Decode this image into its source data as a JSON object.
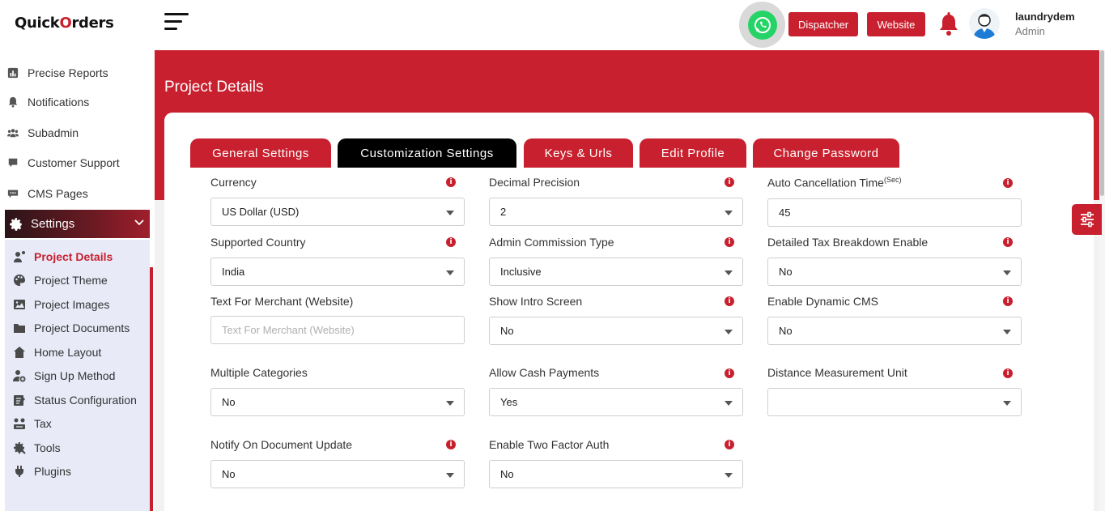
{
  "brand": {
    "logo_text_a": "Quick",
    "logo_text_b": "orders",
    "logo_accent_char": "O"
  },
  "sidebar": {
    "items": [
      {
        "label": "Precise Reports",
        "icon": "report-icon"
      },
      {
        "label": "Notifications",
        "icon": "bell-icon"
      },
      {
        "label": "Subadmin",
        "icon": "users-icon"
      },
      {
        "label": "Customer Support",
        "icon": "support-icon"
      },
      {
        "label": "CMS Pages",
        "icon": "chat-icon"
      }
    ],
    "settings_label": "Settings",
    "submenu": [
      {
        "label": "Project Details",
        "icon": "project-icon",
        "active": true
      },
      {
        "label": "Project Theme",
        "icon": "palette-icon"
      },
      {
        "label": "Project Images",
        "icon": "image-icon"
      },
      {
        "label": "Project Documents",
        "icon": "folder-icon"
      },
      {
        "label": "Home Layout",
        "icon": "home-icon"
      },
      {
        "label": "Sign Up Method",
        "icon": "user-plus-icon"
      },
      {
        "label": "Status Configuration",
        "icon": "status-icon"
      },
      {
        "label": "Tax",
        "icon": "tax-icon"
      },
      {
        "label": "Tools",
        "icon": "tools-icon"
      },
      {
        "label": "Plugins",
        "icon": "plug-icon"
      }
    ]
  },
  "header": {
    "dispatcher_label": "Dispatcher",
    "website_label": "Website",
    "user_name": "laundrydem",
    "user_role": "Admin"
  },
  "page": {
    "title": "Project Details",
    "tabs": [
      {
        "label": "General Settings"
      },
      {
        "label": "Customization Settings",
        "active": true
      },
      {
        "label": "Keys & Urls"
      },
      {
        "label": "Edit Profile"
      },
      {
        "label": "Change Password"
      }
    ]
  },
  "form": {
    "currency": {
      "label": "Currency",
      "value": "US Dollar (USD)"
    },
    "decimal_precision": {
      "label": "Decimal Precision",
      "value": "2"
    },
    "auto_cancellation": {
      "label": "Auto Cancellation Time",
      "label_sup": "(Sec)",
      "value": "45"
    },
    "supported_country": {
      "label": "Supported Country",
      "value": "India"
    },
    "admin_commission_type": {
      "label": "Admin Commission Type",
      "value": "Inclusive"
    },
    "detailed_tax": {
      "label": "Detailed Tax Breakdown Enable",
      "value": "No"
    },
    "text_for_merchant": {
      "label": "Text For Merchant (Website)",
      "placeholder": "Text For Merchant (Website)",
      "value": ""
    },
    "show_intro_screen": {
      "label": "Show Intro Screen",
      "value": "No"
    },
    "enable_dynamic_cms": {
      "label": "Enable Dynamic CMS",
      "value": "No"
    },
    "multiple_categories": {
      "label": "Multiple Categories",
      "value": "No"
    },
    "allow_cash_payments": {
      "label": "Allow Cash Payments",
      "value": "Yes"
    },
    "distance_unit": {
      "label": "Distance Measurement Unit",
      "value": ""
    },
    "notify_document_update": {
      "label": "Notify On Document Update",
      "value": "No"
    },
    "two_factor_auth": {
      "label": "Enable Two Factor Auth",
      "value": "No"
    }
  },
  "colors": {
    "accent": "#c8202e",
    "active_tab": "#000000",
    "submenu_bg": "#e8eaf8"
  }
}
